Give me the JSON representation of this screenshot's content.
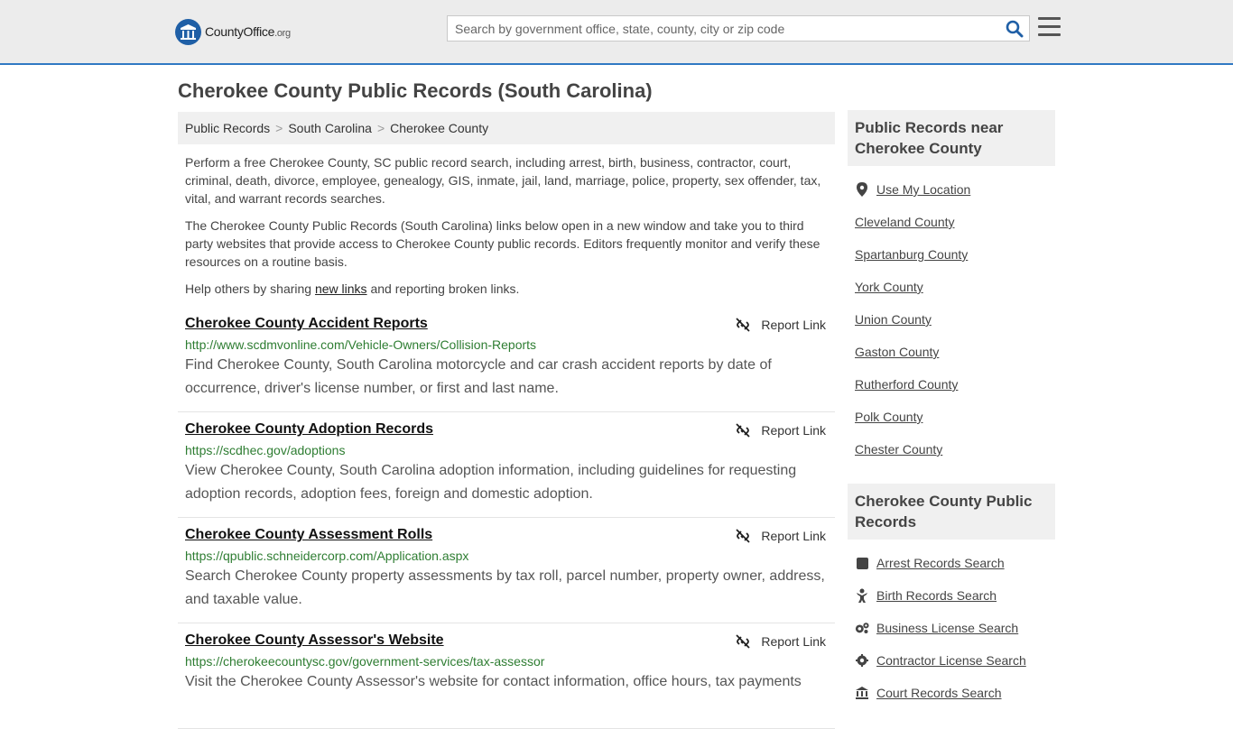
{
  "header": {
    "logo_main": "CountyOffice",
    "logo_tld": ".org",
    "search_placeholder": "Search by government office, state, county, city or zip code"
  },
  "page_title": "Cherokee County Public Records (South Carolina)",
  "breadcrumb": [
    "Public Records",
    "South Carolina",
    "Cherokee County"
  ],
  "intro": {
    "p1": "Perform a free Cherokee County, SC public record search, including arrest, birth, business, contractor, court, criminal, death, divorce, employee, genealogy, GIS, inmate, jail, land, marriage, police, property, sex offender, tax, vital, and warrant records searches.",
    "p2": "The Cherokee County Public Records (South Carolina) links below open in a new window and take you to third party websites that provide access to Cherokee County public records. Editors frequently monitor and verify these resources on a routine basis.",
    "p3_before": "Help others by sharing ",
    "p3_link": "new links",
    "p3_after": " and reporting broken links."
  },
  "report_label": "Report Link",
  "records": [
    {
      "title": "Cherokee County Accident Reports",
      "url": "http://www.scdmvonline.com/Vehicle-Owners/Collision-Reports",
      "desc": "Find Cherokee County, South Carolina motorcycle and car crash accident reports by date of occurrence, driver's license number, or first and last name."
    },
    {
      "title": "Cherokee County Adoption Records",
      "url": "https://scdhec.gov/adoptions",
      "desc": "View Cherokee County, South Carolina adoption information, including guidelines for requesting adoption records, adoption fees, foreign and domestic adoption."
    },
    {
      "title": "Cherokee County Assessment Rolls",
      "url": "https://qpublic.schneidercorp.com/Application.aspx",
      "desc": "Search Cherokee County property assessments by tax roll, parcel number, property owner, address, and taxable value."
    },
    {
      "title": "Cherokee County Assessor's Website",
      "url": "https://cherokeecountysc.gov/government-services/tax-assessor",
      "desc": "Visit the Cherokee County Assessor's website for contact information, office hours, tax payments"
    }
  ],
  "sidebar": {
    "near_heading": "Public Records near Cherokee County",
    "use_location": "Use My Location",
    "near": [
      "Cleveland County",
      "Spartanburg County",
      "York County",
      "Union County",
      "Gaston County",
      "Rutherford County",
      "Polk County",
      "Chester County"
    ],
    "records_heading": "Cherokee County Public Records",
    "records_links": [
      {
        "label": "Arrest Records Search",
        "icon": "square-icon"
      },
      {
        "label": "Birth Records Search",
        "icon": "baby-icon"
      },
      {
        "label": "Business License Search",
        "icon": "gears-icon"
      },
      {
        "label": "Contractor License Search",
        "icon": "gear-icon"
      },
      {
        "label": "Court Records Search",
        "icon": "courthouse-icon"
      }
    ]
  }
}
